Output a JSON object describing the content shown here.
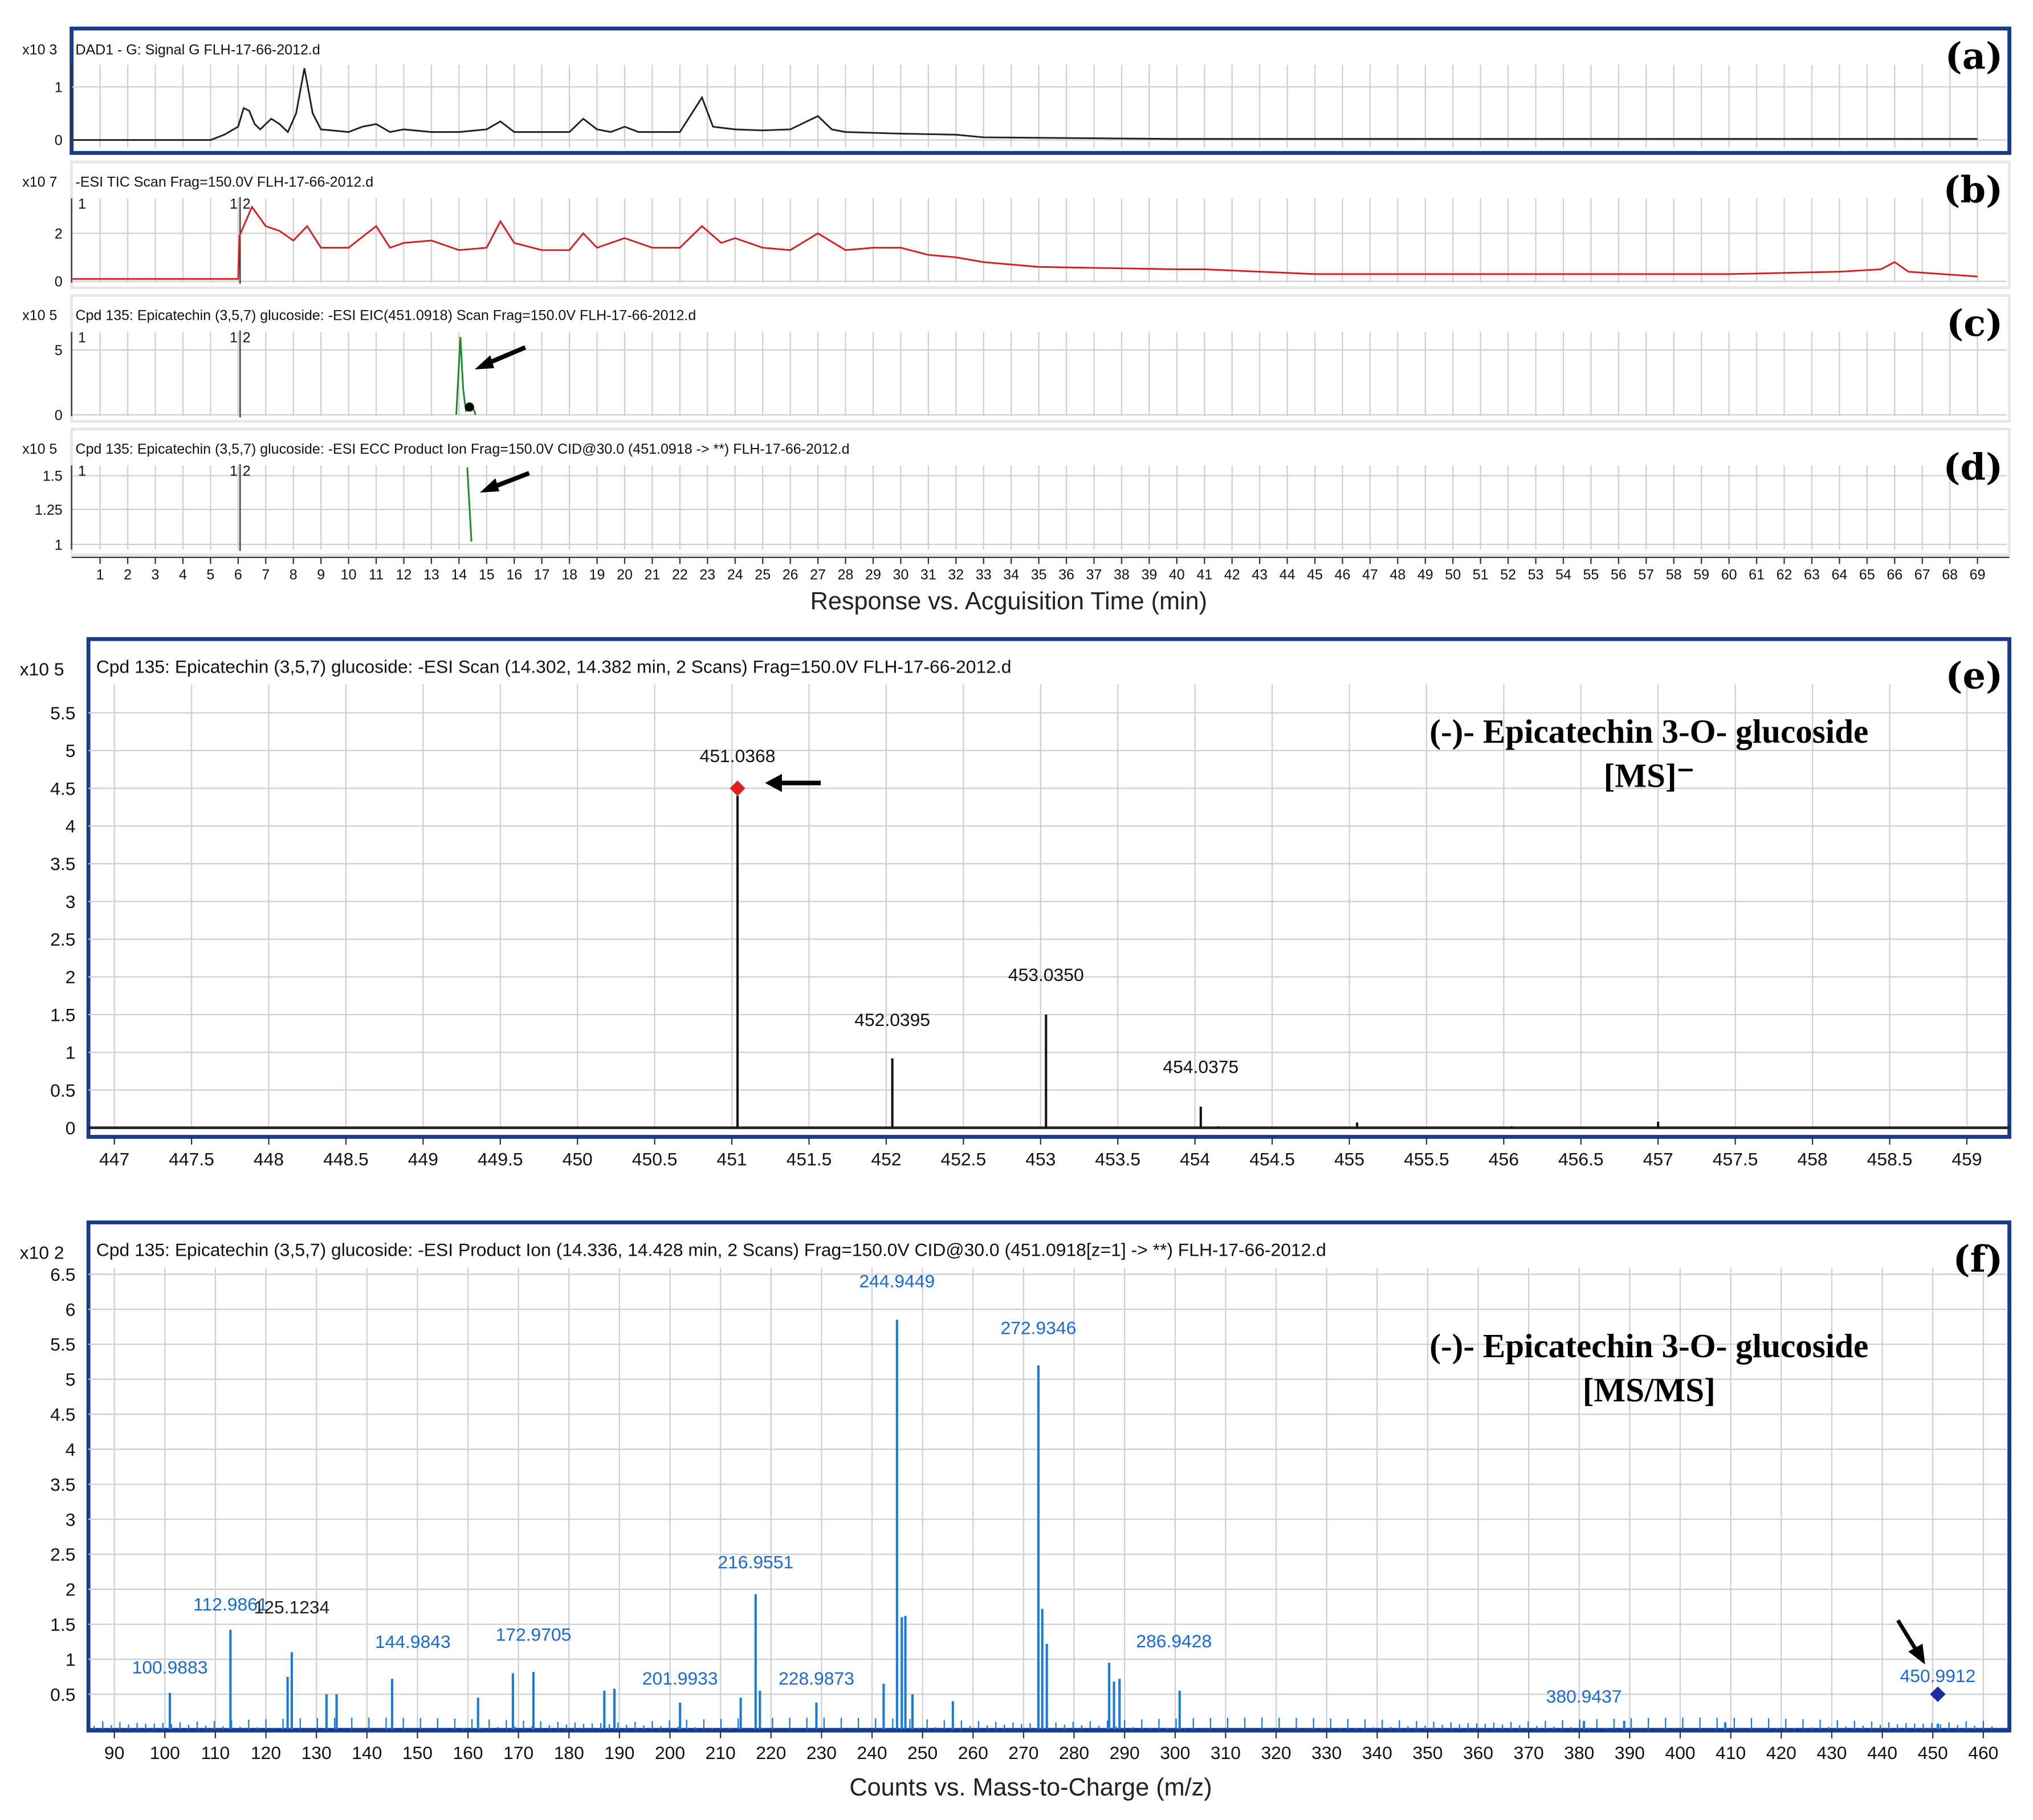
{
  "chart_data": [
    {
      "panel": "(a)",
      "type": "line",
      "title": "DAD1 - G: Signal G FLH-17-66-2012.d",
      "y_multiplier": "x10 3",
      "yticks": [
        "0",
        "1"
      ],
      "ylim": [
        -0.1,
        1.4
      ],
      "color": "#222222",
      "x": [
        0,
        5,
        5.5,
        6,
        6.2,
        6.4,
        6.6,
        6.8,
        7.2,
        7.5,
        7.8,
        8.1,
        8.4,
        8.7,
        9,
        10,
        10.5,
        11,
        11.5,
        12,
        13,
        14,
        15,
        15.5,
        16,
        17,
        18,
        18.5,
        19,
        19.5,
        20,
        20.5,
        22,
        22.8,
        23.2,
        24,
        25,
        26,
        27,
        27.5,
        28,
        30,
        32,
        33,
        40,
        69
      ],
      "y": [
        0,
        0,
        0.1,
        0.25,
        0.6,
        0.55,
        0.3,
        0.2,
        0.4,
        0.3,
        0.15,
        0.5,
        1.35,
        0.5,
        0.2,
        0.15,
        0.25,
        0.3,
        0.15,
        0.2,
        0.15,
        0.15,
        0.2,
        0.35,
        0.15,
        0.15,
        0.15,
        0.4,
        0.2,
        0.15,
        0.25,
        0.15,
        0.15,
        0.8,
        0.25,
        0.2,
        0.18,
        0.2,
        0.45,
        0.2,
        0.15,
        0.12,
        0.1,
        0.05,
        0.02,
        0.02
      ]
    },
    {
      "panel": "(b)",
      "type": "line",
      "title": "-ESI TIC Scan Frag=150.0V FLH-17-66-2012.d",
      "y_multiplier": "x10 7",
      "yticks": [
        "0",
        "2"
      ],
      "ylim": [
        0,
        3.4
      ],
      "color": "#d42020",
      "segment_marks": [
        "1",
        "1",
        "2"
      ],
      "x": [
        0,
        6,
        6.05,
        6.5,
        7,
        7.5,
        8,
        8.5,
        9,
        10,
        11,
        11.5,
        12,
        13,
        14,
        15,
        15.5,
        16,
        17,
        18,
        18.5,
        19,
        20,
        21,
        22,
        22.8,
        23.5,
        24,
        25,
        26,
        27,
        28,
        29,
        30,
        31,
        32,
        33,
        35,
        40,
        41,
        45,
        60,
        64,
        65.5,
        66,
        66.5,
        69
      ],
      "y": [
        0.1,
        0.1,
        1.9,
        3.1,
        2.3,
        2.1,
        1.7,
        2.3,
        1.4,
        1.4,
        2.3,
        1.4,
        1.6,
        1.7,
        1.3,
        1.4,
        2.5,
        1.6,
        1.3,
        1.3,
        2,
        1.4,
        1.8,
        1.4,
        1.4,
        2.3,
        1.6,
        1.8,
        1.4,
        1.3,
        2,
        1.3,
        1.4,
        1.4,
        1.1,
        1,
        0.8,
        0.6,
        0.5,
        0.5,
        0.3,
        0.3,
        0.4,
        0.5,
        0.8,
        0.4,
        0.2
      ]
    },
    {
      "panel": "(c)",
      "type": "line",
      "title": "Cpd 135: Epicatechin (3,5,7) glucoside: -ESI EIC(451.0918) Scan Frag=150.0V FLH-17-66-2012.d",
      "y_multiplier": "x10 5",
      "yticks": [
        "0",
        "5"
      ],
      "ylim": [
        0,
        6.5
      ],
      "color": "#1a8a2a",
      "segment_marks": [
        "1",
        "1",
        "2"
      ],
      "x": [
        13.9,
        14.05,
        14.15,
        14.25,
        14.5,
        14.6
      ],
      "y": [
        0,
        6,
        2,
        0.3,
        0.6,
        0
      ]
    },
    {
      "panel": "(d)",
      "type": "line",
      "title": "Cpd 135: Epicatechin (3,5,7) glucoside: -ESI ECC Product Ion Frag=150.0V CID@30.0 (451.0918 -> **) FLH-17-66-2012.d",
      "y_multiplier": "x10 5",
      "yticks": [
        "1",
        "1.25",
        "1.5"
      ],
      "ylim": [
        1,
        1.6
      ],
      "color": "#1a8a2a",
      "segment_marks": [
        "1",
        "1",
        "2"
      ],
      "x": [
        14.3,
        14.45
      ],
      "y": [
        1.55,
        1.02
      ]
    },
    {
      "panel": "shared-x",
      "xlabel": "Response vs. Acguisition Time (min)",
      "xticks": [
        "1",
        "2",
        "3",
        "4",
        "5",
        "6",
        "7",
        "8",
        "9",
        "10",
        "11",
        "12",
        "13",
        "14",
        "15",
        "16",
        "17",
        "18",
        "19",
        "20",
        "21",
        "22",
        "23",
        "24",
        "25",
        "26",
        "27",
        "28",
        "29",
        "30",
        "31",
        "32",
        "33",
        "34",
        "35",
        "36",
        "37",
        "38",
        "39",
        "40",
        "41",
        "42",
        "43",
        "44",
        "45",
        "46",
        "47",
        "48",
        "49",
        "50",
        "51",
        "52",
        "53",
        "54",
        "55",
        "56",
        "57",
        "58",
        "59",
        "60",
        "61",
        "62",
        "63",
        "64",
        "65",
        "66",
        "67",
        "68",
        "69"
      ]
    },
    {
      "panel": "(e)",
      "type": "bar",
      "title": "Cpd 135: Epicatechin (3,5,7) glucoside: -ESI Scan (14.302, 14.382 min, 2 Scans) Frag=150.0V FLH-17-66-2012.d",
      "annotation": [
        "(-)- Epicatechin 3-O- glucoside",
        "[MS]⁻"
      ],
      "y_multiplier": "x10 5",
      "xlabel": "",
      "xlim": [
        446.83,
        459.3
      ],
      "ylim": [
        0,
        5.8
      ],
      "yticks": [
        "0",
        "0.5",
        "1",
        "1.5",
        "2",
        "2.5",
        "3",
        "3.5",
        "4",
        "4.5",
        "5",
        "5.5"
      ],
      "xticks": [
        "447",
        "447.5",
        "448",
        "448.5",
        "449",
        "449.5",
        "450",
        "450.5",
        "451",
        "451.5",
        "452",
        "452.5",
        "453",
        "453.5",
        "454",
        "454.5",
        "455",
        "455.5",
        "456",
        "456.5",
        "457",
        "457.5",
        "458",
        "458.5",
        "459"
      ],
      "peaks": [
        {
          "mz": 451.0368,
          "v": 4.4,
          "label": "451.0368"
        },
        {
          "mz": 452.0395,
          "v": 0.92,
          "label": "452.0395"
        },
        {
          "mz": 453.035,
          "v": 1.5,
          "label": "453.0350"
        },
        {
          "mz": 454.0375,
          "v": 0.28,
          "label": "454.0375"
        },
        {
          "mz": 455.05,
          "v": 0.07
        },
        {
          "mz": 456.05,
          "v": 0.02
        },
        {
          "mz": 457.0,
          "v": 0.08
        },
        {
          "mz": 454.15,
          "v": 0.02
        }
      ],
      "marker": {
        "mz": 451.0368,
        "v": 4.5,
        "color": "#e02020"
      }
    },
    {
      "panel": "(f)",
      "type": "bar",
      "title": "Cpd 135: Epicatechin (3,5,7) glucoside: -ESI Product Ion (14.336, 14.428 min, 2 Scans) Frag=150.0V CID@30.0 (451.0918[z=1] -> **) FLH-17-66-2012.d",
      "annotation": [
        "(-)- Epicatechin 3-O- glucoside",
        "[MS/MS]"
      ],
      "y_multiplier": "x10 2",
      "xlabel": "Counts vs. Mass-to-Charge (m/z)",
      "xlim": [
        85,
        463
      ],
      "ylim": [
        0,
        6.7
      ],
      "yticks": [
        "0.5",
        "1",
        "1.5",
        "2",
        "2.5",
        "3",
        "3.5",
        "4",
        "4.5",
        "5",
        "5.5",
        "6",
        "6.5"
      ],
      "xticks": [
        "90",
        "100",
        "110",
        "120",
        "130",
        "140",
        "150",
        "160",
        "170",
        "180",
        "190",
        "200",
        "210",
        "220",
        "230",
        "240",
        "250",
        "260",
        "270",
        "280",
        "290",
        "300",
        "310",
        "320",
        "330",
        "340",
        "350",
        "360",
        "370",
        "380",
        "390",
        "400",
        "410",
        "420",
        "430",
        "440",
        "450",
        "460"
      ],
      "peaks": [
        {
          "mz": 100.9883,
          "v": 0.52,
          "label": "100.9883"
        },
        {
          "mz": 112.9861,
          "v": 1.42,
          "label": "112.9861"
        },
        {
          "mz": 125.1234,
          "v": 1.1,
          "label": "125.1234",
          "label_color": "#222222"
        },
        {
          "mz": 124.3,
          "v": 0.75
        },
        {
          "mz": 132,
          "v": 0.5
        },
        {
          "mz": 134,
          "v": 0.5
        },
        {
          "mz": 144.9843,
          "v": 0.72,
          "label": "144.9843"
        },
        {
          "mz": 162,
          "v": 0.45
        },
        {
          "mz": 168.9,
          "v": 0.8
        },
        {
          "mz": 172.9705,
          "v": 0.82,
          "label": "172.9705"
        },
        {
          "mz": 187,
          "v": 0.55
        },
        {
          "mz": 189,
          "v": 0.58
        },
        {
          "mz": 201.9933,
          "v": 0.38,
          "label": "201.9933"
        },
        {
          "mz": 214,
          "v": 0.45
        },
        {
          "mz": 216.9551,
          "v": 1.93,
          "label": "216.9551"
        },
        {
          "mz": 217.8,
          "v": 0.55
        },
        {
          "mz": 228.9873,
          "v": 0.38,
          "label": "228.9873"
        },
        {
          "mz": 242.3,
          "v": 0.65
        },
        {
          "mz": 244.9449,
          "v": 5.85,
          "label": "244.9449"
        },
        {
          "mz": 245.9,
          "v": 1.6
        },
        {
          "mz": 246.6,
          "v": 1.62
        },
        {
          "mz": 248,
          "v": 0.5
        },
        {
          "mz": 256,
          "v": 0.4
        },
        {
          "mz": 272.9346,
          "v": 5.2,
          "label": "272.9346"
        },
        {
          "mz": 273.7,
          "v": 1.72
        },
        {
          "mz": 274.6,
          "v": 1.22
        },
        {
          "mz": 286.9428,
          "v": 0.95,
          "label": "286.9428"
        },
        {
          "mz": 287.9,
          "v": 0.68
        },
        {
          "mz": 289,
          "v": 0.72
        },
        {
          "mz": 300.9,
          "v": 0.55
        },
        {
          "mz": 380.9437,
          "v": 0.12,
          "label": "380.9437"
        },
        {
          "mz": 388.9,
          "v": 0.12
        },
        {
          "mz": 408.9,
          "v": 0.1
        },
        {
          "mz": 450.9912,
          "v": 0.08,
          "label": "450.9912"
        }
      ],
      "marker": {
        "mz": 450.9912,
        "v": 0.5,
        "color": "#1a2aa0"
      }
    }
  ],
  "panel_labels": [
    "(a)",
    "(b)",
    "(c)",
    "(d)",
    "(e)",
    "(f)"
  ]
}
